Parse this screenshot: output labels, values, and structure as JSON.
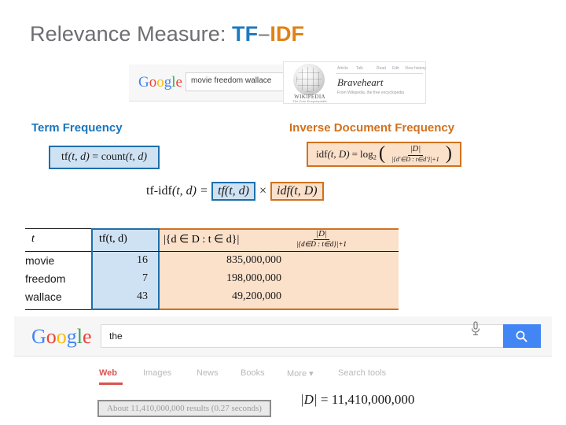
{
  "slide": {
    "title": {
      "lead": "Relevance Measure: ",
      "tf": "TF",
      "dash": "–",
      "idf": "IDF"
    }
  },
  "google_top": {
    "logo": "Google",
    "query": "movie freedom wallace"
  },
  "wikipedia": {
    "tabs": [
      "Article",
      "Talk",
      "Read",
      "Edit",
      "View history"
    ],
    "article_title": "Braveheart",
    "from_line": "From Wikipedia, the free encyclopedia",
    "wordmark": "WIKIPEDIA",
    "tagline": "The Free Encyclopedia"
  },
  "sections": {
    "tf_heading": "Term Frequency",
    "idf_heading": "Inverse Document Frequency"
  },
  "formulas": {
    "tf": {
      "lhs_fn": "tf",
      "lhs_args": "(t, d)",
      "eq": "=",
      "rhs_fn": "count",
      "rhs_args": "(t, d)"
    },
    "idf": {
      "fn": "idf",
      "args": "(t, D)",
      "eq": "=",
      "log": "log",
      "log_base": "2",
      "numerator": "|D|",
      "denominator": "|{d'∈D : t∈d'}|+1"
    },
    "tfidf": {
      "lhs": "tf-idf",
      "lhs_args": "(t, d)",
      "eq": "=",
      "tf_term": "tf(t, d)",
      "times": "×",
      "idf_term": "idf(t, D)"
    }
  },
  "table": {
    "headers": {
      "term": "t",
      "tf": "tf(t, d)",
      "doc_count": "|{d ∈ D : t ∈ d}|",
      "frac_num": "|D|",
      "frac_den": "|{d∈D : t∈d}|+1"
    },
    "rows": [
      {
        "term": "movie",
        "tf": "16",
        "doc_count": "835,000,000"
      },
      {
        "term": "freedom",
        "tf": "7",
        "doc_count": "198,000,000"
      },
      {
        "term": "wallace",
        "tf": "43",
        "doc_count": "49,200,000"
      }
    ]
  },
  "google_bottom": {
    "logo": "Google",
    "query": "the",
    "nav": [
      "Web",
      "Images",
      "News",
      "Books",
      "More ▾",
      "Search tools"
    ],
    "results_text": "About 11,410,000,000 results (0.27 seconds)"
  },
  "d_total": {
    "lhs": "|D|",
    "eq": "=",
    "value": "11,410,000,000"
  },
  "colors": {
    "tf_blue": "#1f6fab",
    "tf_blue_fill": "#cfe2f3",
    "idf_orange": "#d2711e",
    "idf_orange_fill": "#fbe0ca",
    "title_gray": "#6d6e71",
    "heading_blue": "#1b75bb",
    "google_blue": "#4285f4",
    "active_red": "#d9534f"
  }
}
